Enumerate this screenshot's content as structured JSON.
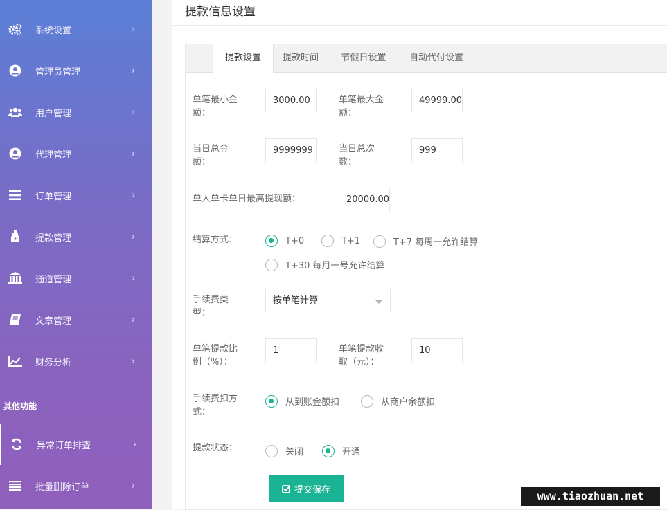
{
  "sidebar": {
    "items": [
      {
        "label": "系统设置",
        "icon": "gears-icon"
      },
      {
        "label": "管理员管理",
        "icon": "user-circle-icon"
      },
      {
        "label": "用户管理",
        "icon": "users-icon"
      },
      {
        "label": "代理管理",
        "icon": "user-circle-icon"
      },
      {
        "label": "订单管理",
        "icon": "list-icon"
      },
      {
        "label": "提款管理",
        "icon": "hand-icon"
      },
      {
        "label": "通道管理",
        "icon": "bank-icon"
      },
      {
        "label": "文章管理",
        "icon": "book-icon"
      },
      {
        "label": "财务分析",
        "icon": "line-chart-icon"
      }
    ],
    "section_title": "其他功能",
    "extra_items": [
      {
        "label": "异常订单排查",
        "icon": "refresh-icon"
      },
      {
        "label": "批量删除订单",
        "icon": "list-icon"
      }
    ],
    "chevron": "›"
  },
  "page": {
    "title": "提款信息设置"
  },
  "tabs": [
    {
      "label": "提款设置",
      "active": true
    },
    {
      "label": "提款时间",
      "active": false
    },
    {
      "label": "节假日设置",
      "active": false
    },
    {
      "label": "自动代付设置",
      "active": false
    }
  ],
  "form": {
    "min_amount": {
      "label_1": "单笔最小金",
      "label_2": "额：",
      "value": "3000.00"
    },
    "max_amount": {
      "label_1": "单笔最大金",
      "label_2": "额：",
      "value": "49999.00"
    },
    "daily_total": {
      "label_1": "当日总金",
      "label_2": "额：",
      "value": "9999999"
    },
    "daily_count": {
      "label_1": "当日总次",
      "label_2": "数：",
      "value": "999"
    },
    "single_card_max": {
      "label": "单人单卡单日最高提现额：",
      "value": "20000.00"
    },
    "settlement": {
      "label": "结算方式：",
      "options": [
        "T+0",
        "T+1",
        "T+7 每周一允许结算",
        "T+30 每月一号允许结算"
      ],
      "selected": "T+0"
    },
    "fee_type": {
      "label_1": "手续费类",
      "label_2": "型：",
      "value": "按单笔计算"
    },
    "fee_ratio": {
      "label_1": "单笔提款比",
      "label_2": "例（%）：",
      "value": "1"
    },
    "fee_fixed": {
      "label_1": "单笔提款收",
      "label_2": "取（元）：",
      "value": "10"
    },
    "deduct_from": {
      "label_1": "手续费扣方",
      "label_2": "式：",
      "options": [
        "从到账金额扣",
        "从商户余额扣"
      ],
      "selected": "从到账金额扣"
    },
    "status": {
      "label": "提款状态：",
      "options": [
        "关闭",
        "开通"
      ],
      "selected": "开通"
    },
    "submit_label": "提交保存"
  },
  "watermark": "www.tiaozhuan.net",
  "colors": {
    "accent": "#1ab394",
    "sidebar_top": "#5b7fd6",
    "sidebar_bottom": "#8f5fbc"
  }
}
